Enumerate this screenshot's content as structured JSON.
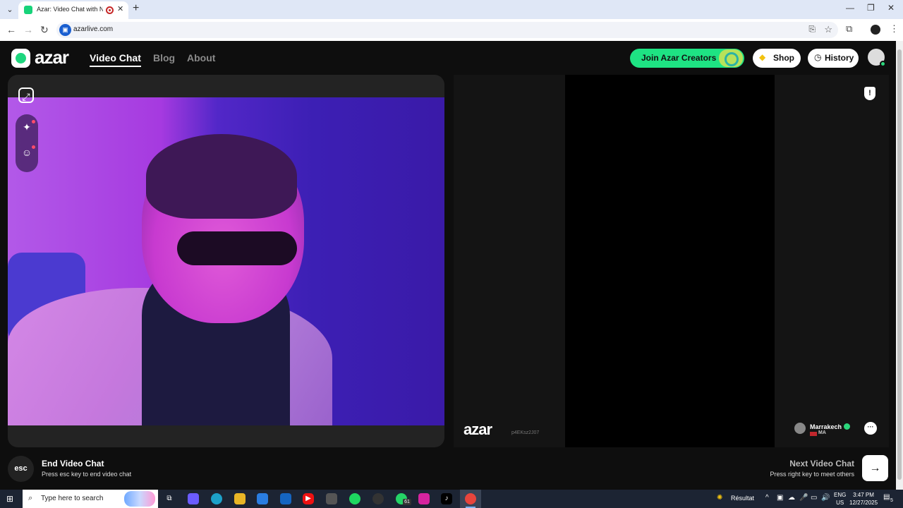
{
  "browser": {
    "tab_title": "Azar: Video Chat with New",
    "url": "azarlive.com",
    "controls": {
      "minimize": "—",
      "restore": "❐",
      "close": "✕"
    }
  },
  "site": {
    "logo_text": "azar",
    "nav": [
      "Video Chat",
      "Blog",
      "About"
    ],
    "join_creators": "Join Azar Creators",
    "shop": "Shop",
    "history": "History"
  },
  "video": {
    "watermark_logo": "azar",
    "watermark_code": "p4EKsz2J07",
    "partner_city": "Marrakech",
    "partner_country": "MA"
  },
  "footer": {
    "esc_key": "esc",
    "end_title": "End Video Chat",
    "end_sub": "Press esc key to end video chat",
    "next_title": "Next Video Chat",
    "next_sub": "Press right key to meet others",
    "next_arrow": "→"
  },
  "taskbar": {
    "search_placeholder": "Type here to search",
    "weather_label": "Résultat",
    "lang_top": "ENG",
    "lang_bottom": "US",
    "time": "3:47 PM",
    "date": "12/27/2025",
    "whatsapp_badge": "61",
    "notif_count": "5"
  },
  "colors": {
    "brand_green": "#1ee383",
    "page_bg": "#0e0e0e"
  }
}
